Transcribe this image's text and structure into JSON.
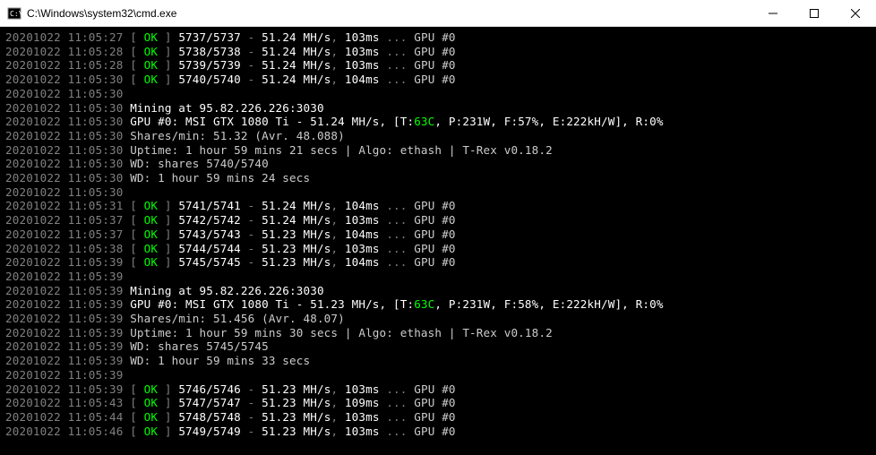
{
  "window": {
    "title": "C:\\Windows\\system32\\cmd.exe"
  },
  "lines": [
    {
      "type": "share",
      "ts": "20201022 11:05:27",
      "ok": "OK",
      "sh": "5737/5737",
      "rate": "51.24 MH/s",
      "ms": "103ms",
      "gpu": "GPU #0"
    },
    {
      "type": "share",
      "ts": "20201022 11:05:28",
      "ok": "OK",
      "sh": "5738/5738",
      "rate": "51.24 MH/s",
      "ms": "103ms",
      "gpu": "GPU #0"
    },
    {
      "type": "share",
      "ts": "20201022 11:05:28",
      "ok": "OK",
      "sh": "5739/5739",
      "rate": "51.24 MH/s",
      "ms": "103ms",
      "gpu": "GPU #0"
    },
    {
      "type": "share",
      "ts": "20201022 11:05:30",
      "ok": "OK",
      "sh": "5740/5740",
      "rate": "51.24 MH/s",
      "ms": "104ms",
      "gpu": "GPU #0"
    },
    {
      "type": "tsonly",
      "ts": "20201022 11:05:30"
    },
    {
      "type": "mine",
      "ts": "20201022 11:05:30",
      "text": "Mining at 95.82.226.226:3030"
    },
    {
      "type": "gpu",
      "ts": "20201022 11:05:30",
      "pre": "GPU #0: MSI GTX 1080 Ti - 51.24 MH/s, [T:",
      "temp": "63C",
      "post": ", P:231W, F:57%, E:222kH/W], R:0%"
    },
    {
      "type": "plain",
      "ts": "20201022 11:05:30",
      "text": "Shares/min: 51.32 (Avr. 48.088)"
    },
    {
      "type": "plain",
      "ts": "20201022 11:05:30",
      "text": "Uptime: 1 hour 59 mins 21 secs | Algo: ethash | T-Rex v0.18.2"
    },
    {
      "type": "plain",
      "ts": "20201022 11:05:30",
      "text": "WD: shares 5740/5740"
    },
    {
      "type": "plain",
      "ts": "20201022 11:05:30",
      "text": "WD: 1 hour 59 mins 24 secs"
    },
    {
      "type": "tsonly",
      "ts": "20201022 11:05:30"
    },
    {
      "type": "share",
      "ts": "20201022 11:05:31",
      "ok": "OK",
      "sh": "5741/5741",
      "rate": "51.24 MH/s",
      "ms": "104ms",
      "gpu": "GPU #0"
    },
    {
      "type": "share",
      "ts": "20201022 11:05:37",
      "ok": "OK",
      "sh": "5742/5742",
      "rate": "51.24 MH/s",
      "ms": "103ms",
      "gpu": "GPU #0"
    },
    {
      "type": "share",
      "ts": "20201022 11:05:37",
      "ok": "OK",
      "sh": "5743/5743",
      "rate": "51.23 MH/s",
      "ms": "104ms",
      "gpu": "GPU #0"
    },
    {
      "type": "share",
      "ts": "20201022 11:05:38",
      "ok": "OK",
      "sh": "5744/5744",
      "rate": "51.23 MH/s",
      "ms": "103ms",
      "gpu": "GPU #0"
    },
    {
      "type": "share",
      "ts": "20201022 11:05:39",
      "ok": "OK",
      "sh": "5745/5745",
      "rate": "51.23 MH/s",
      "ms": "104ms",
      "gpu": "GPU #0"
    },
    {
      "type": "tsonly",
      "ts": "20201022 11:05:39"
    },
    {
      "type": "mine",
      "ts": "20201022 11:05:39",
      "text": "Mining at 95.82.226.226:3030"
    },
    {
      "type": "gpu",
      "ts": "20201022 11:05:39",
      "pre": "GPU #0: MSI GTX 1080 Ti - 51.23 MH/s, [T:",
      "temp": "63C",
      "post": ", P:231W, F:58%, E:222kH/W], R:0%"
    },
    {
      "type": "plain",
      "ts": "20201022 11:05:39",
      "text": "Shares/min: 51.456 (Avr. 48.07)"
    },
    {
      "type": "plain",
      "ts": "20201022 11:05:39",
      "text": "Uptime: 1 hour 59 mins 30 secs | Algo: ethash | T-Rex v0.18.2"
    },
    {
      "type": "plain",
      "ts": "20201022 11:05:39",
      "text": "WD: shares 5745/5745"
    },
    {
      "type": "plain",
      "ts": "20201022 11:05:39",
      "text": "WD: 1 hour 59 mins 33 secs"
    },
    {
      "type": "tsonly",
      "ts": "20201022 11:05:39"
    },
    {
      "type": "share",
      "ts": "20201022 11:05:39",
      "ok": "OK",
      "sh": "5746/5746",
      "rate": "51.23 MH/s",
      "ms": "103ms",
      "gpu": "GPU #0"
    },
    {
      "type": "share",
      "ts": "20201022 11:05:43",
      "ok": "OK",
      "sh": "5747/5747",
      "rate": "51.23 MH/s",
      "ms": "109ms",
      "gpu": "GPU #0"
    },
    {
      "type": "share",
      "ts": "20201022 11:05:44",
      "ok": "OK",
      "sh": "5748/5748",
      "rate": "51.23 MH/s",
      "ms": "103ms",
      "gpu": "GPU #0"
    },
    {
      "type": "share",
      "ts": "20201022 11:05:46",
      "ok": "OK",
      "sh": "5749/5749",
      "rate": "51.23 MH/s",
      "ms": "103ms",
      "gpu": "GPU #0"
    }
  ]
}
